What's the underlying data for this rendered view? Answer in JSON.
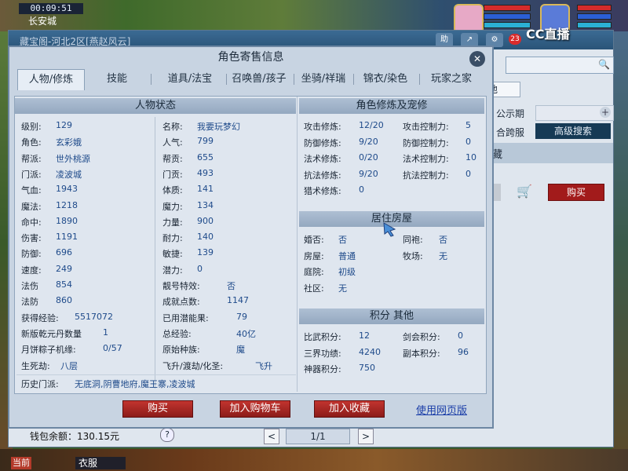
{
  "hud": {
    "clock": "00:09:51",
    "city": "长安城"
  },
  "background_window": {
    "title": "藏宝阁-河北2区[燕赵风云]",
    "icons": [
      "助",
      "分享",
      "设置"
    ],
    "chat_count": "23",
    "cc_logo": "CC直播",
    "tab_fragment": "他",
    "publicity_label": "公示期",
    "cross_server_label": "合跨服",
    "advanced_search": "高级搜索",
    "collect_label": "藏",
    "buy_label": "购买",
    "wallet": "钱包余额：130.15元",
    "help": "?",
    "pager_prev": "<",
    "pager_text": "1/1",
    "pager_next": ">"
  },
  "bottom_bar": {
    "left_label": "当前",
    "clothes": "衣服"
  },
  "dialog": {
    "title": "角色寄售信息",
    "close": "✕",
    "tabs": [
      "人物/修炼",
      "技能",
      "道具/法宝",
      "召唤兽/孩子",
      "坐骑/祥瑞",
      "锦衣/染色",
      "玩家之家"
    ],
    "active_tab": 0,
    "status_header": "人物状态",
    "status_left": [
      {
        "label": "级别:",
        "value": "129"
      },
      {
        "label": "角色:",
        "value": "玄彩娥"
      },
      {
        "label": "帮派:",
        "value": "世外桃源"
      },
      {
        "label": "门派:",
        "value": "凌波城"
      },
      {
        "label": "气血:",
        "value": "1943"
      },
      {
        "label": "魔法:",
        "value": "1218"
      },
      {
        "label": "命中:",
        "value": "1890"
      },
      {
        "label": "伤害:",
        "value": "1191"
      },
      {
        "label": "防御:",
        "value": "696"
      },
      {
        "label": "速度:",
        "value": "249"
      },
      {
        "label": "法伤",
        "value": "854"
      },
      {
        "label": "法防",
        "value": "860"
      },
      {
        "label": "获得经验:",
        "value": "5517072"
      },
      {
        "label": "新版乾元丹数量",
        "value": "1"
      },
      {
        "label": "月饼粽子机缘:",
        "value": "0/57"
      },
      {
        "label": "生死劫:",
        "value": "八层"
      }
    ],
    "status_right": [
      {
        "label": "名称:",
        "value": "我要玩梦幻"
      },
      {
        "label": "人气:",
        "value": "799"
      },
      {
        "label": "帮贡:",
        "value": "655"
      },
      {
        "label": "门贡:",
        "value": "493"
      },
      {
        "label": "体质:",
        "value": "141"
      },
      {
        "label": "魔力:",
        "value": "134"
      },
      {
        "label": "力量:",
        "value": "900"
      },
      {
        "label": "耐力:",
        "value": "140"
      },
      {
        "label": "敏捷:",
        "value": "139"
      },
      {
        "label": "潜力:",
        "value": "0"
      },
      {
        "label": "靓号特效:",
        "value": "否"
      },
      {
        "label": "成就点数:",
        "value": "1147"
      },
      {
        "label": "已用潜能果:",
        "value": "79"
      },
      {
        "label": "总经验:",
        "value": "40亿"
      },
      {
        "label": "原始种族:",
        "value": "魔"
      },
      {
        "label": "飞升/渡劫/化圣:",
        "value": "飞升"
      }
    ],
    "history_label": "历史门派:",
    "history_value": "无底洞,阴曹地府,魔王寨,凌波城",
    "cultivation_header": "角色修炼及宠修",
    "cultivation_left": [
      {
        "label": "攻击修炼:",
        "value": "12/20"
      },
      {
        "label": "防御修炼:",
        "value": "9/20"
      },
      {
        "label": "法术修炼:",
        "value": "0/20"
      },
      {
        "label": "抗法修炼:",
        "value": "9/20"
      },
      {
        "label": "猎术修炼:",
        "value": "0"
      }
    ],
    "cultivation_right": [
      {
        "label": "攻击控制力:",
        "value": "5"
      },
      {
        "label": "防御控制力:",
        "value": "0"
      },
      {
        "label": "法术控制力:",
        "value": "10"
      },
      {
        "label": "抗法控制力:",
        "value": "0"
      }
    ],
    "house_header": "居住房屋",
    "house_left": [
      {
        "label": "婚否:",
        "value": "否"
      },
      {
        "label": "房屋:",
        "value": "普通"
      },
      {
        "label": "庭院:",
        "value": "初级"
      },
      {
        "label": "社区:",
        "value": "无"
      }
    ],
    "house_right": [
      {
        "label": "同袍:",
        "value": "否"
      },
      {
        "label": "牧场:",
        "value": "无"
      }
    ],
    "score_header": "积分 其他",
    "score_left": [
      {
        "label": "比武积分:",
        "value": "12"
      },
      {
        "label": "三界功绩:",
        "value": "4240"
      },
      {
        "label": "神器积分:",
        "value": "750"
      }
    ],
    "score_right": [
      {
        "label": "剑会积分:",
        "value": "0"
      },
      {
        "label": "副本积分:",
        "value": "96"
      }
    ],
    "buttons": {
      "buy": "购买",
      "add_cart": "加入购物车",
      "add_collect": "加入收藏",
      "web_version": "使用网页版"
    }
  }
}
